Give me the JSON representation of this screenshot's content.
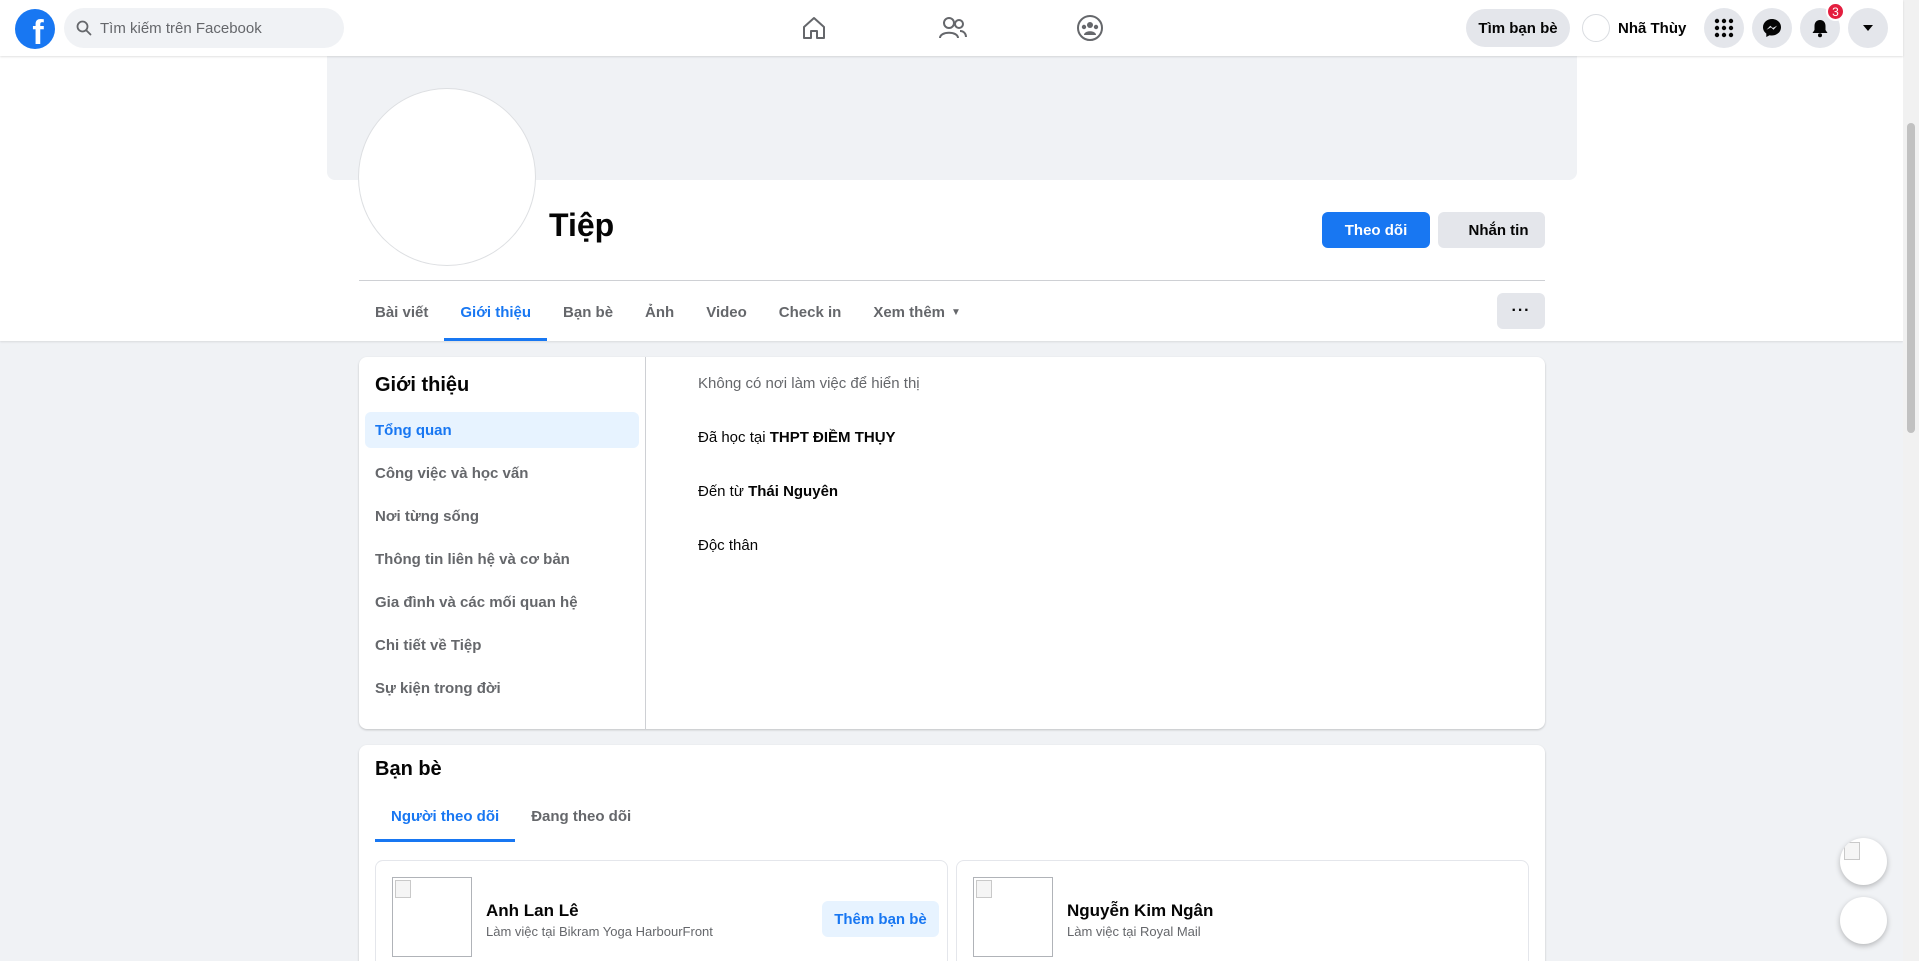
{
  "topbar": {
    "logo_letter": "f",
    "search_placeholder": "Tìm kiếm trên Facebook",
    "find_friends_label": "Tìm bạn bè",
    "user_name": "Nhã Thùy",
    "notification_count": "3"
  },
  "profile": {
    "name": "Tiệp",
    "follow_label": "Theo dõi",
    "message_label": "Nhắn tin",
    "more_label": "···"
  },
  "tabs": [
    {
      "label": "Bài viết"
    },
    {
      "label": "Giới thiệu"
    },
    {
      "label": "Bạn bè"
    },
    {
      "label": "Ảnh"
    },
    {
      "label": "Video"
    },
    {
      "label": "Check in"
    },
    {
      "label": "Xem thêm"
    }
  ],
  "about": {
    "title": "Giới thiệu",
    "menu": [
      {
        "label": "Tổng quan"
      },
      {
        "label": "Công việc và học vấn"
      },
      {
        "label": "Nơi từng sống"
      },
      {
        "label": "Thông tin liên hệ và cơ bản"
      },
      {
        "label": "Gia đình và các mối quan hệ"
      },
      {
        "label": "Chi tiết về Tiệp"
      },
      {
        "label": "Sự kiện trong đời"
      }
    ],
    "no_work": "Không có nơi làm việc để hiển thị",
    "studied_prefix": "Đã học tại ",
    "studied_place": "THPT ĐIỀM THỤY",
    "from_prefix": "Đến từ ",
    "from_place": "Thái Nguyên",
    "relationship": "Độc thân"
  },
  "friends": {
    "title": "Bạn bè",
    "tabs": [
      {
        "label": "Người theo dõi"
      },
      {
        "label": "Đang theo dõi"
      }
    ],
    "items": [
      {
        "name": "Anh Lan Lê",
        "subtitle": "Làm việc tại Bikram Yoga HarbourFront",
        "add_label": "Thêm bạn bè"
      },
      {
        "name": "Nguyễn Kim Ngân",
        "subtitle": "Làm việc tại Royal Mail"
      }
    ]
  },
  "colors": {
    "brand": "#1877f2",
    "badge": "#e41e3f",
    "page_bg": "#f0f2f5"
  }
}
